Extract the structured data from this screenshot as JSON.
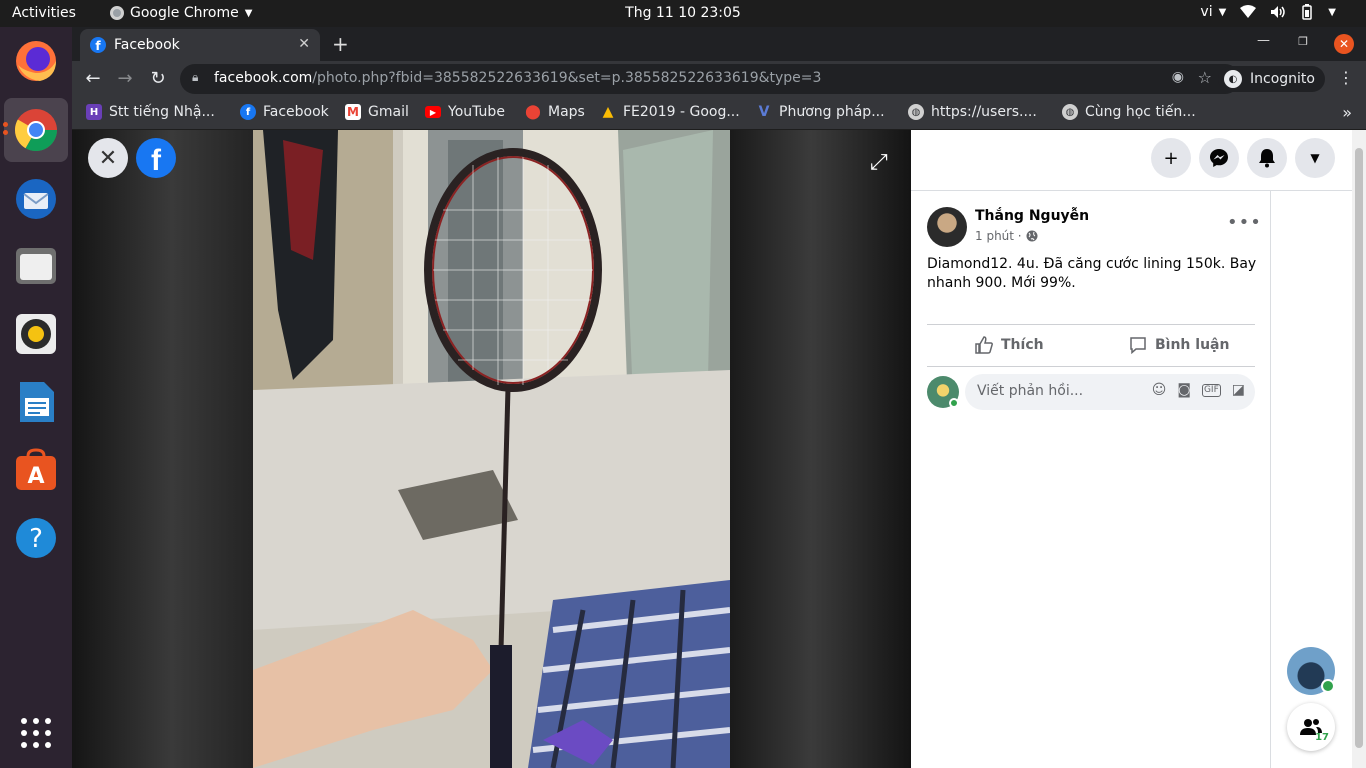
{
  "os": {
    "activities": "Activities",
    "app_name": "Google Chrome",
    "clock": "Thg 11 10  23:05",
    "lang": "vi"
  },
  "browser": {
    "tab_title": "Facebook",
    "url_host": "facebook.com",
    "url_path": "/photo.php?fbid=385582522633619&set=p.385582522633619&type=3",
    "incognito_label": "Incognito",
    "bookmarks": [
      {
        "label": "Stt tiếng Nhậ...",
        "icon": "bookmark-stt-icon",
        "color": "#6a3fb8"
      },
      {
        "label": "Facebook",
        "icon": "facebook-icon",
        "color": "#1877f2"
      },
      {
        "label": "Gmail",
        "icon": "gmail-icon",
        "color": "#ea4335"
      },
      {
        "label": "YouTube",
        "icon": "youtube-icon",
        "color": "#ff0000"
      },
      {
        "label": "Maps",
        "icon": "maps-icon",
        "color": "#34a853"
      },
      {
        "label": "FE2019 - Goog...",
        "icon": "google-drive-icon",
        "color": "#fbbc04"
      },
      {
        "label": "Phương pháp...",
        "icon": "vietjack-icon",
        "color": "#5b7bd5"
      },
      {
        "label": "https://users....",
        "icon": "globe-icon",
        "color": "#9aa0a6"
      },
      {
        "label": "Cùng học tiến...",
        "icon": "globe-icon",
        "color": "#9aa0a6"
      }
    ]
  },
  "post": {
    "author": "Thắng Nguyễn",
    "time": "1 phút ·",
    "text": "Diamond12. 4u. Đã căng cước lining 150k. Bay nhanh 900. Mới 99%.",
    "like_label": "Thích",
    "comment_label": "Bình luận",
    "comment_placeholder": "Viết phản hồi..."
  },
  "contacts": {
    "count": "17"
  },
  "colors": {
    "fb_blue": "#1877f2",
    "ubuntu_orange": "#e95420",
    "online_green": "#31a24c"
  }
}
